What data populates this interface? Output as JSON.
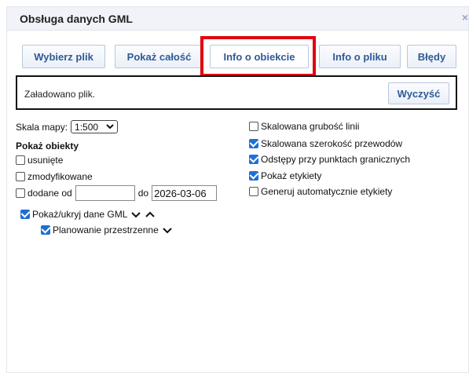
{
  "window": {
    "title": "Obsługa danych GML"
  },
  "tabs": [
    {
      "label": "Wybierz plik"
    },
    {
      "label": "Pokaż całość"
    },
    {
      "label": "Info o obiekcie",
      "active": true
    },
    {
      "label": "Info o pliku"
    },
    {
      "label": "Błędy"
    }
  ],
  "message": {
    "text": "Załadowano plik.",
    "clear_label": "Wyczyść"
  },
  "left": {
    "scale_label": "Skala mapy:",
    "scale_value": "1:500",
    "show_objects_heading": "Pokaż obiekty",
    "deleted_label": "usunięte",
    "modified_label": "zmodyfikowane",
    "added_from_label": "dodane od",
    "added_from_value": "",
    "to_label": "do",
    "to_value": "2026-03-06",
    "toggle_gml_label": "Pokaż/ukryj dane GML",
    "planning_label": "Planowanie przestrzenne"
  },
  "right": {
    "scaled_line_thickness": "Skalowana grubość linii",
    "scaled_wire_width": "Skalowana szerokość przewodów",
    "boundary_point_spacing": "Odstępy przy punktach granicznych",
    "show_labels": "Pokaż etykiety",
    "auto_labels": "Generuj automatycznie etykiety"
  },
  "checkbox_states": {
    "deleted": false,
    "modified": false,
    "added_from": false,
    "toggle_gml": true,
    "planning": true,
    "scaled_line_thickness": false,
    "scaled_wire_width": true,
    "boundary_point_spacing": true,
    "show_labels": true,
    "auto_labels": false
  },
  "colors": {
    "highlight": "#e2000f",
    "accent": "#1f6fd6",
    "tab_text": "#2f5a96"
  }
}
